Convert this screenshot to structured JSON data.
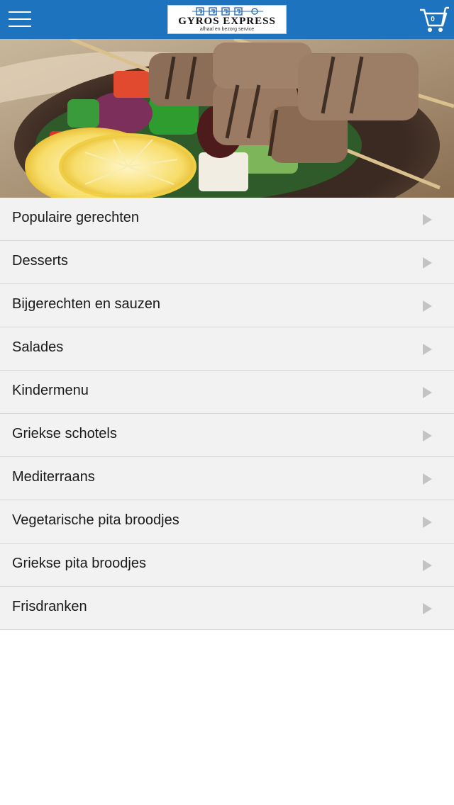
{
  "header": {
    "menu_icon": "hamburger-menu-icon",
    "logo": {
      "title": "GYROS EXPRESS",
      "subtitle": "afhaal en bezorg service"
    },
    "cart": {
      "icon": "shopping-cart-icon",
      "count": "0"
    }
  },
  "hero": {
    "image": "souvlaki-skewers-salad-photo"
  },
  "menu": {
    "arrow_icon": "chevron-right-icon",
    "items": [
      {
        "label": "Populaire gerechten"
      },
      {
        "label": "Desserts"
      },
      {
        "label": "Bijgerechten en sauzen"
      },
      {
        "label": "Salades"
      },
      {
        "label": "Kindermenu"
      },
      {
        "label": "Griekse schotels"
      },
      {
        "label": "Mediterraans"
      },
      {
        "label": "Vegetarische pita broodjes"
      },
      {
        "label": "Griekse pita broodjes"
      },
      {
        "label": "Frisdranken"
      }
    ]
  },
  "colors": {
    "header_bg": "#1e73be",
    "list_bg": "#f2f2f2",
    "separator": "#d6d6d6",
    "arrow": "#c3c3c3"
  }
}
